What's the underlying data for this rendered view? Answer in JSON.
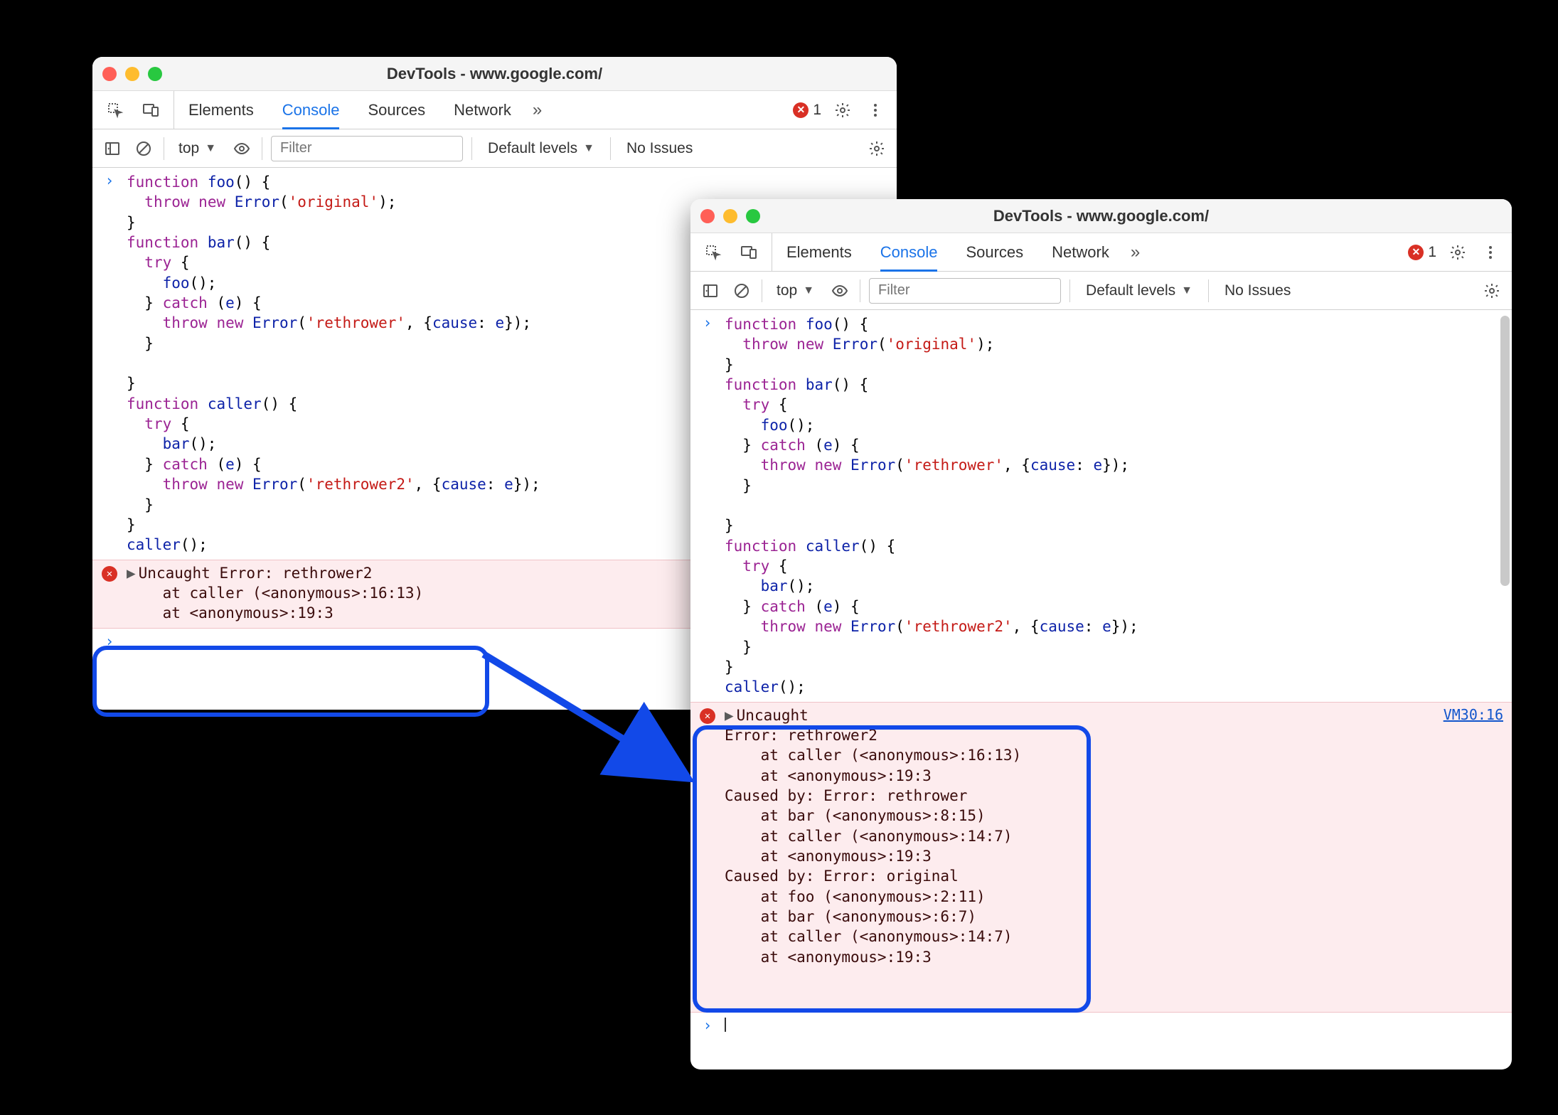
{
  "window1": {
    "title": "DevTools - www.google.com/",
    "tabs": {
      "elements": "Elements",
      "console": "Console",
      "sources": "Sources",
      "network": "Network"
    },
    "error_badge": {
      "count": "1"
    },
    "filter": {
      "context": "top",
      "placeholder": "Filter",
      "levels": "Default levels",
      "issues": "No Issues"
    },
    "code": "function foo() {\n  throw new Error('original');\n}\nfunction bar() {\n  try {\n    foo();\n  } catch (e) {\n    throw new Error('rethrower', {cause: e});\n  }\n\n}\nfunction caller() {\n  try {\n    bar();\n  } catch (e) {\n    throw new Error('rethrower2', {cause: e});\n  }\n}\ncaller();",
    "error": "Uncaught Error: rethrower2\n    at caller (<anonymous>:16:13)\n    at <anonymous>:19:3"
  },
  "window2": {
    "title": "DevTools - www.google.com/",
    "tabs": {
      "elements": "Elements",
      "console": "Console",
      "sources": "Sources",
      "network": "Network"
    },
    "error_badge": {
      "count": "1"
    },
    "filter": {
      "context": "top",
      "placeholder": "Filter",
      "levels": "Default levels",
      "issues": "No Issues"
    },
    "code": "function foo() {\n  throw new Error('original');\n}\nfunction bar() {\n  try {\n    foo();\n  } catch (e) {\n    throw new Error('rethrower', {cause: e});\n  }\n\n}\nfunction caller() {\n  try {\n    bar();\n  } catch (e) {\n    throw new Error('rethrower2', {cause: e});\n  }\n}\ncaller();",
    "error_link": "VM30:16",
    "error": "Uncaught\nError: rethrower2\n    at caller (<anonymous>:16:13)\n    at <anonymous>:19:3\nCaused by: Error: rethrower\n    at bar (<anonymous>:8:15)\n    at caller (<anonymous>:14:7)\n    at <anonymous>:19:3\nCaused by: Error: original\n    at foo (<anonymous>:2:11)\n    at bar (<anonymous>:6:7)\n    at caller (<anonymous>:14:7)\n    at <anonymous>:19:3"
  }
}
